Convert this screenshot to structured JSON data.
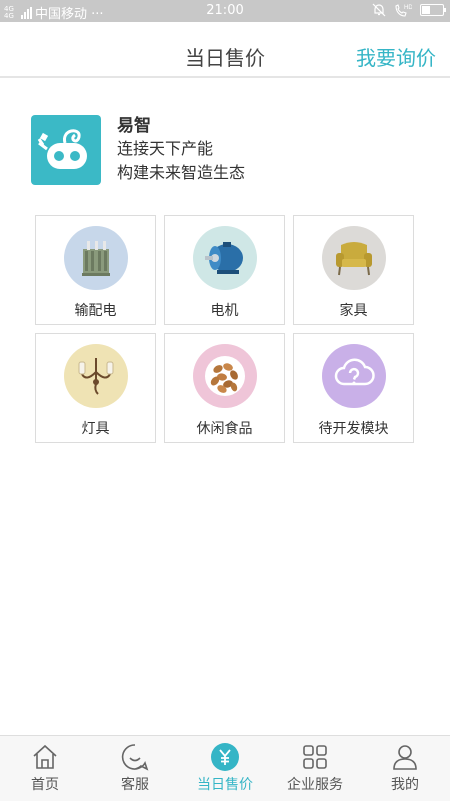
{
  "status_bar": {
    "network": "4G 4G",
    "carrier": "中国移动 ···",
    "time": "21:00",
    "battery_level": 0.4
  },
  "header": {
    "title": "当日售价",
    "inquiry_link": "我要询价"
  },
  "brand": {
    "name": "易智",
    "slogan_lines": [
      "连接天下产能",
      "构建未来智造生态"
    ],
    "logo_color": "#3bb9c6"
  },
  "categories": [
    {
      "label": "输配电",
      "icon": "transformer-icon",
      "bg": "#c7d7ea"
    },
    {
      "label": "电机",
      "icon": "motor-icon",
      "bg": "#cfe7e6"
    },
    {
      "label": "家具",
      "icon": "armchair-icon",
      "bg": "#dcdad7"
    },
    {
      "label": "灯具",
      "icon": "wall-lamp-icon",
      "bg": "#efe3b4"
    },
    {
      "label": "休闲食品",
      "icon": "nuts-icon",
      "bg": "#efc5d8"
    },
    {
      "label": "待开发模块",
      "icon": "cloud-question-icon",
      "bg": "#c9b0e8"
    }
  ],
  "tabbar": {
    "items": [
      {
        "label": "首页",
        "icon": "home-icon"
      },
      {
        "label": "客服",
        "icon": "chat-icon"
      },
      {
        "label": "当日售价",
        "icon": "yuan-icon"
      },
      {
        "label": "企业服务",
        "icon": "grid-icon"
      },
      {
        "label": "我的",
        "icon": "user-icon"
      }
    ],
    "active_index": 2
  },
  "colors": {
    "accent": "#35b5c6",
    "status_bar": "#c8c8c8"
  }
}
